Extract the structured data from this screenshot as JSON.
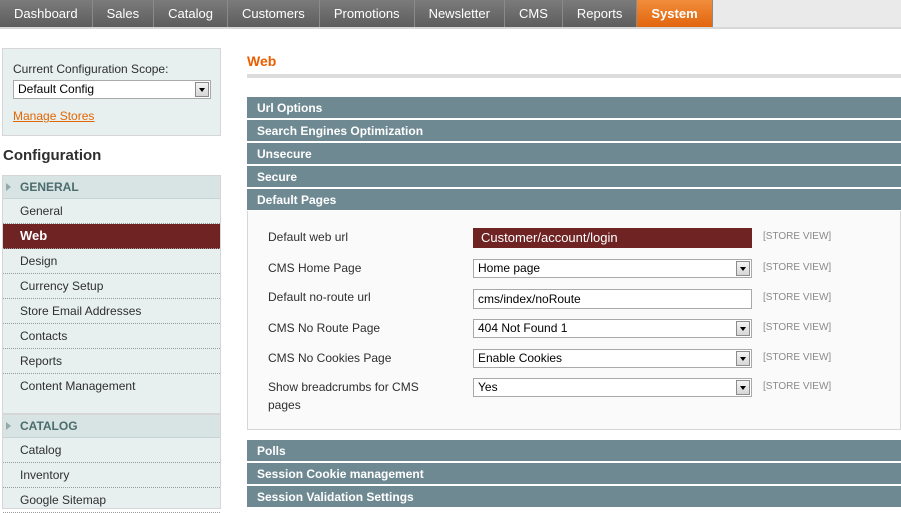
{
  "nav": {
    "items": [
      {
        "label": "Dashboard"
      },
      {
        "label": "Sales"
      },
      {
        "label": "Catalog"
      },
      {
        "label": "Customers"
      },
      {
        "label": "Promotions"
      },
      {
        "label": "Newsletter"
      },
      {
        "label": "CMS"
      },
      {
        "label": "Reports"
      },
      {
        "label": "System",
        "active": true
      }
    ]
  },
  "sidebar": {
    "scope_label": "Current Configuration Scope:",
    "scope_value": "Default Config",
    "manage_stores": "Manage Stores",
    "config_title": "Configuration",
    "general": {
      "heading": "GENERAL",
      "items": [
        "General",
        "Web",
        "Design",
        "Currency Setup",
        "Store Email Addresses",
        "Contacts",
        "Reports",
        "Content Management"
      ],
      "active": "Web"
    },
    "catalog": {
      "heading": "CATALOG",
      "items": [
        "Catalog",
        "Inventory",
        "Google Sitemap"
      ]
    }
  },
  "main": {
    "title": "Web",
    "sections_top": [
      "Url Options",
      "Search Engines Optimization",
      "Unsecure",
      "Secure",
      "Default Pages"
    ],
    "sections_bottom": [
      "Polls",
      "Session Cookie management",
      "Session Validation Settings"
    ],
    "scope_note": "[STORE VIEW]",
    "fields": {
      "default_web_url": {
        "label": "Default web url",
        "value": "Customer/account/login"
      },
      "cms_home_page": {
        "label": "CMS Home Page",
        "value": "Home page"
      },
      "default_no_route": {
        "label": "Default no-route url",
        "value": "cms/index/noRoute"
      },
      "cms_no_route": {
        "label": "CMS No Route Page",
        "value": "404 Not Found 1"
      },
      "cms_no_cookies": {
        "label": "CMS No Cookies Page",
        "value": "Enable Cookies"
      },
      "breadcrumbs": {
        "label": "Show breadcrumbs for CMS pages",
        "value": "Yes"
      }
    }
  },
  "colors": {
    "accent_orange": "#eb5e00",
    "active_item": "#6f2323",
    "section_bar": "#6f8992"
  }
}
